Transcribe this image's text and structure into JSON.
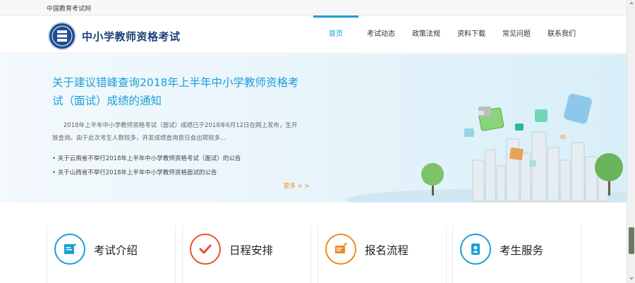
{
  "topbar": {
    "site_name": "中国教育考试网"
  },
  "header": {
    "title": "中小学教师资格考试",
    "nav": [
      {
        "label": "首页",
        "active": true
      },
      {
        "label": "考试动态",
        "active": false
      },
      {
        "label": "政策法规",
        "active": false
      },
      {
        "label": "资料下载",
        "active": false
      },
      {
        "label": "常见问题",
        "active": false
      },
      {
        "label": "联系我们",
        "active": false
      }
    ]
  },
  "banner": {
    "headline": "关于建议错峰查询2018年上半年中小学教师资格考试（面试）成绩的通知",
    "summary": "2018年上半年中小学教师资格考试（面试）成绩已于2018年6月12日在网上发布，生开放查询。由于此次考生人数较多，并发成绩查询首日会出现较多...",
    "links": [
      "关于云南省不举行2018年上半年中小学教师资格考试（面试）的公告",
      "关于山西省不举行2018年上半年中小学教师资格面试的公告"
    ],
    "more_label": "更多 > >"
  },
  "services": [
    {
      "label": "考试介绍",
      "icon": "exam-intro-icon",
      "color": "#1a9fd9"
    },
    {
      "label": "日程安排",
      "icon": "schedule-check-icon",
      "color": "#e8532b"
    },
    {
      "label": "报名流程",
      "icon": "registration-flow-icon",
      "color": "#f08a1c"
    },
    {
      "label": "考生服务",
      "icon": "candidate-service-icon",
      "color": "#1a9fd9"
    }
  ],
  "colors": {
    "accent": "#1a9fd9",
    "brand": "#1d4d8e",
    "more": "#f08a1c"
  }
}
